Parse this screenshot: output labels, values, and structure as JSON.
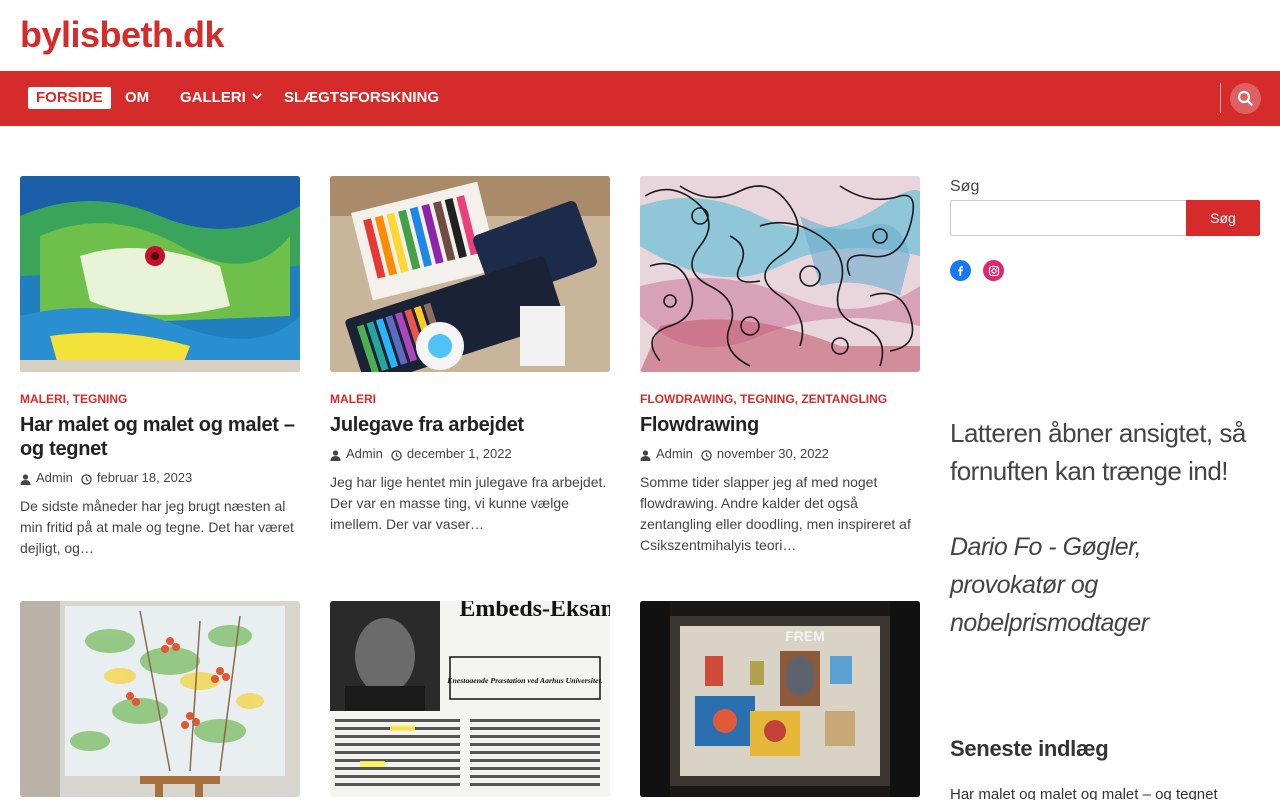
{
  "site": {
    "title": "bylisbeth.dk"
  },
  "colors": {
    "accent": "#d52b2b",
    "text": "#333333"
  },
  "nav": {
    "items": [
      {
        "label": "FORSIDE",
        "active": true
      },
      {
        "label": "OM"
      },
      {
        "label": "GALLERI",
        "has_dropdown": true
      },
      {
        "label": "SLÆGTSFORSKNING"
      }
    ],
    "search_icon": "search-icon"
  },
  "posts": [
    {
      "categories": [
        "MALERI",
        "TEGNING"
      ],
      "title": "Har malet og malet og malet – og tegnet",
      "author": "Admin",
      "date": "februar 18, 2023",
      "excerpt": "De sidste måneder har jeg brugt næsten al min fritid på at male og tegne. Det har været dejligt, og…",
      "image": "colorful abstract painting"
    },
    {
      "categories": [
        "MALERI"
      ],
      "title": "Julegave fra arbejdet",
      "author": "Admin",
      "date": "december 1, 2022",
      "excerpt": "Jeg har lige hentet min julegave fra arbejdet. Der var en masse ting, vi kunne vælge imellem. Der var vaser…",
      "image": "art supplies set"
    },
    {
      "categories": [
        "FLOWDRAWING",
        "TEGNING",
        "ZENTANGLING"
      ],
      "title": "Flowdrawing",
      "author": "Admin",
      "date": "november 30, 2022",
      "excerpt": "Somme tider slapper jeg af med noget flowdrawing. Andre kalder det også zentangling eller doodling, men inspireret af Csikszentmihalyis teori…",
      "image": "flowdrawing pattern"
    },
    {
      "image": "painting on easel"
    },
    {
      "image": "newspaper clipping",
      "clip_headline": "Embeds-Eksamen.",
      "clip_sub": "Enestaaende Præstation ved Aarhus Universitet."
    },
    {
      "image": "gallery window",
      "clip_headline": "FREM"
    }
  ],
  "sidebar": {
    "search_label": "Søg",
    "search_placeholder": "",
    "search_button": "Søg",
    "socials": [
      "facebook-icon",
      "instagram-icon"
    ],
    "quote": "Latteren åbner ansigtet, så fornuften kan trænge ind!",
    "quote_author": "Dario Fo - Gøgler, provokatør og nobelprismodtager",
    "recent_heading": "Seneste indlæg",
    "recent_items": [
      "Har malet og malet og malet – og tegnet"
    ]
  }
}
